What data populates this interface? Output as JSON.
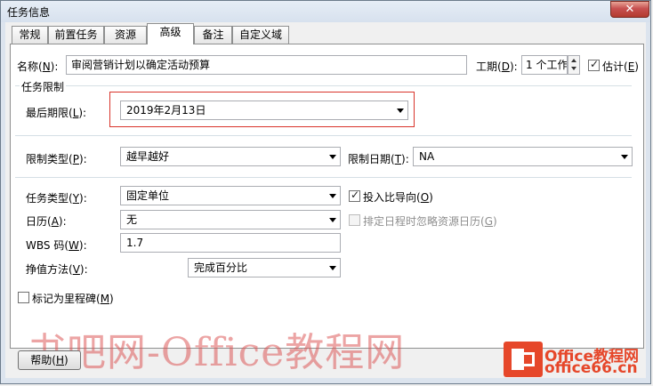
{
  "window": {
    "title": "任务信息",
    "close_glyph": "✕"
  },
  "tabs": [
    {
      "label": "常规"
    },
    {
      "label": "前置任务"
    },
    {
      "label": "资源"
    },
    {
      "label": "高级"
    },
    {
      "label": "备注"
    },
    {
      "label": "自定义域"
    }
  ],
  "active_tab": "高级",
  "name": {
    "label": "名称(",
    "key": "N",
    "label_end": "):",
    "value": "审阅营销计划以确定活动预算"
  },
  "duration": {
    "label": "工期(",
    "key": "D",
    "label_end": "):",
    "value": "1 个工作日",
    "estimated_label": "估计(",
    "estimated_key": "E",
    "estimated_end": ")",
    "estimated_checked": true
  },
  "constraint_group": {
    "title": "任务限制"
  },
  "deadline": {
    "label": "最后期限(",
    "key": "L",
    "label_end": "):",
    "value": "2019年2月13日"
  },
  "constraint_type": {
    "label": "限制类型(",
    "key": "P",
    "label_end": "):",
    "value": "越早越好"
  },
  "constraint_date": {
    "label": "限制日期(",
    "key": "T",
    "label_end": "):",
    "value": "NA"
  },
  "task_type": {
    "label": "任务类型(",
    "key": "Y",
    "label_end": "):",
    "value": "固定单位"
  },
  "effort_driven": {
    "label": "投入比导向(",
    "key": "O",
    "label_end": ")",
    "checked": true
  },
  "calendar": {
    "label": "日历(",
    "key": "A",
    "label_end": "):",
    "value": "无"
  },
  "ignore_resource_cal": {
    "label": "排定日程时忽略资源日历(",
    "key": "G",
    "label_end": ")",
    "checked": false
  },
  "wbs": {
    "label": "WBS 码(",
    "key": "W",
    "label_end": "):",
    "value": "1.7"
  },
  "earned_value": {
    "label": "挣值方法(",
    "key": "V",
    "label_end": "):",
    "value": "完成百分比"
  },
  "milestone": {
    "label": "标记为里程碑(",
    "key": "M",
    "label_end": ")",
    "checked": false
  },
  "help_button": {
    "label": "帮助(",
    "key": "H",
    "label_end": ")"
  },
  "watermark": {
    "text": "书吧网-Office教程网"
  },
  "logo": {
    "line1": "Office教程网",
    "line2": "office66.cn"
  },
  "colors": {
    "highlight_border": "#d9342b",
    "accent": "#e6472a"
  }
}
